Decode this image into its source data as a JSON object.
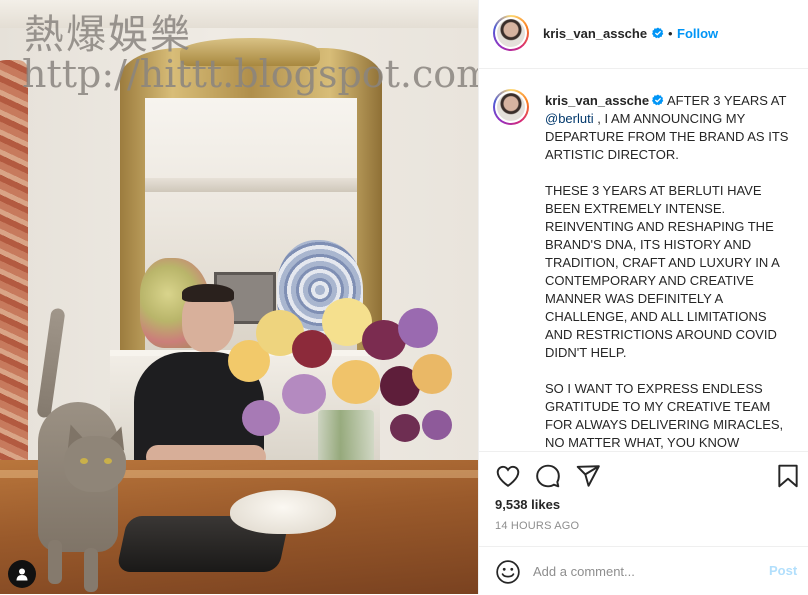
{
  "watermark": {
    "title": "熱爆娛樂",
    "url": "http://hittt.blogspot.com"
  },
  "post": {
    "image_alt": "photo",
    "tag_icon": "user-tag-icon"
  },
  "header": {
    "username": "kris_van_assche",
    "separator": "•",
    "follow_label": "Follow"
  },
  "caption": {
    "username": "kris_van_assche",
    "intro": " AFTER 3 YEARS AT ",
    "mention": "@berluti",
    "rest": " , I AM ANNOUNCING MY DEPARTURE FROM THE BRAND AS ITS ARTISTIC DIRECTOR.\n\nTHESE 3 YEARS AT BERLUTI HAVE BEEN EXTREMELY INTENSE. REINVENTING AND RESHAPING THE BRAND'S DNA, ITS HISTORY AND TRADITION, CRAFT AND LUXURY IN A CONTEMPORARY AND CREATIVE MANNER WAS DEFINITELY A CHALLENGE, AND ALL LIMITATIONS AND RESTRICTIONS AROUND COVID DIDN'T HELP.\n\nSO I WANT TO EXPRESS ENDLESS GRATITUDE TO MY CREATIVE TEAM FOR ALWAYS DELIVERING MIRACLES, NO MATTER WHAT, YOU KNOW"
  },
  "actions": {
    "like_icon": "heart-icon",
    "comment_icon": "comment-icon",
    "share_icon": "paper-plane-icon",
    "save_icon": "bookmark-icon"
  },
  "stats": {
    "likes": "9,538 likes",
    "time": "14 HOURS AGO"
  },
  "comment": {
    "placeholder": "Add a comment...",
    "post_label": "Post"
  },
  "colors": {
    "accent": "#0095f6",
    "post_disabled": "#b2dffc",
    "mention": "#00376b",
    "muted": "#8e8e8e"
  }
}
